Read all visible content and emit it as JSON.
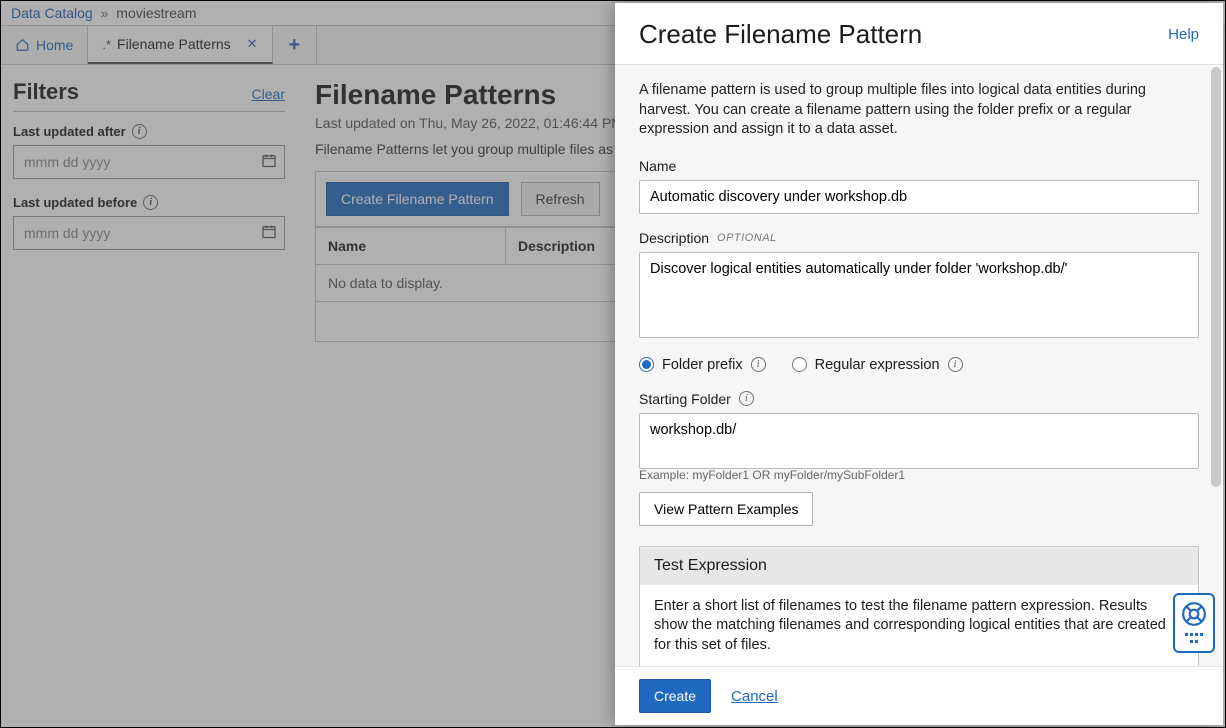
{
  "breadcrumb": {
    "root": "Data Catalog",
    "current": "moviestream"
  },
  "tabs": {
    "home": "Home",
    "filename": "Filename Patterns"
  },
  "sidebar": {
    "title": "Filters",
    "clear": "Clear",
    "after_label": "Last updated after",
    "before_label": "Last updated before",
    "placeholder": "mmm dd yyyy"
  },
  "main": {
    "title": "Filename Patterns",
    "sub": "Last updated on Thu, May 26, 2022, 01:46:44 PM",
    "desc": "Filename Patterns let you group multiple files as",
    "create_btn": "Create Filename Pattern",
    "refresh_btn": "Refresh",
    "col_name": "Name",
    "col_desc": "Description",
    "empty": "No data to display."
  },
  "drawer": {
    "title": "Create Filename Pattern",
    "help": "Help",
    "intro": "A filename pattern is used to group multiple files into logical data entities during harvest. You can create a filename pattern using the folder prefix or a regular expression and assign it to a data asset.",
    "name_label": "Name",
    "name_value": "Automatic discovery under workshop.db",
    "desc_label": "Description",
    "optional": "Optional",
    "desc_value": "Discover logical entities automatically under folder 'workshop.db/'",
    "radio_folder": "Folder prefix",
    "radio_regex": "Regular expression",
    "starting_label": "Starting Folder",
    "starting_value": "workshop.db/",
    "example": "Example: myFolder1 OR myFolder/mySubFolder1",
    "view_examples": "View Pattern Examples",
    "test_title": "Test Expression",
    "test_body": "Enter a short list of filenames to test the filename pattern expression. Results show the matching filenames and corresponding logical entities that are created for this set of files.",
    "create": "Create",
    "cancel": "Cancel"
  }
}
